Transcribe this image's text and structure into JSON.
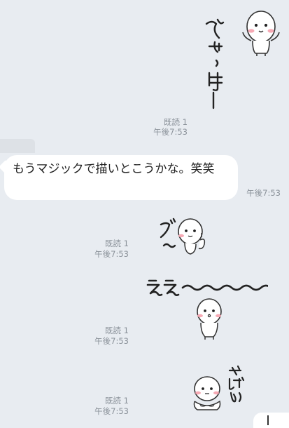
{
  "messages": [
    {
      "kind": "sticker",
      "side": "right",
      "sticker_text": "ひゃっほー",
      "read": "既読 1",
      "time": "午後7:53"
    },
    {
      "kind": "text",
      "side": "left",
      "text": "もうマジックで描いとこうかな。笑笑",
      "time": "午後7:53"
    },
    {
      "kind": "sticker",
      "side": "right",
      "sticker_text": "グ〜",
      "read": "既読 1",
      "time": "午後7:53"
    },
    {
      "kind": "sticker",
      "side": "right",
      "sticker_text": "ええ〜〜〜〜〜",
      "read": "既読 1",
      "time": "午後7:53"
    },
    {
      "kind": "sticker",
      "side": "right",
      "sticker_text": "やばい",
      "read": "既読 1",
      "time": "午後7:53"
    }
  ],
  "colors": {
    "background": "#e8ecf1",
    "bubble": "#ffffff",
    "meta_text": "#8c939b",
    "cheek": "#f6a9b4"
  }
}
